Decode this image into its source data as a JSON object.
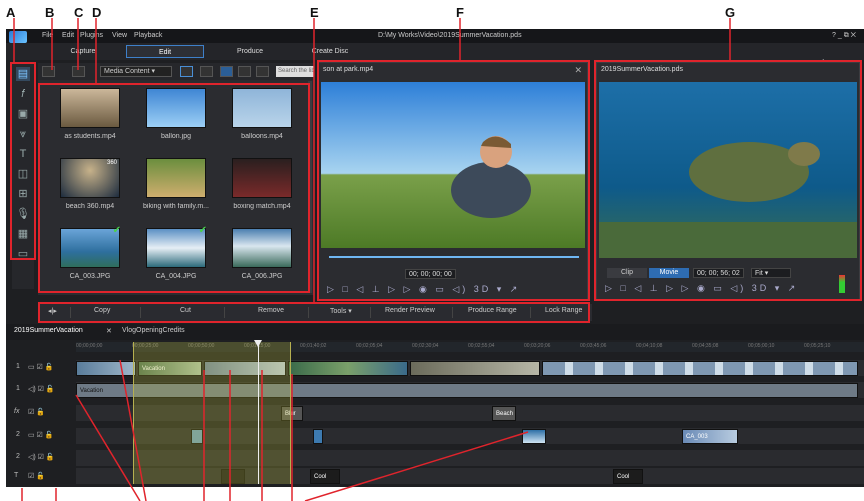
{
  "callouts": [
    "A",
    "B",
    "C",
    "D",
    "E",
    "F",
    "G"
  ],
  "app": {
    "menu": [
      "File",
      "Edit",
      "Plugins",
      "View",
      "Playback"
    ],
    "path": "D:\\My Works\\Video\\2019SummerVacation.pds",
    "window_controls": "?  _  ⧉  ✕",
    "modes": [
      "Capture",
      "Edit",
      "Produce",
      "Create Disc"
    ],
    "brand": "PowerDirector"
  },
  "library": {
    "filter": "Media Content",
    "search_placeholder": "Search the library",
    "items": [
      {
        "name": "as students.mp4",
        "checked": false
      },
      {
        "name": "ballon.jpg",
        "checked": false
      },
      {
        "name": "balloons.mp4",
        "checked": false
      },
      {
        "name": "beach 360.mp4",
        "checked": false,
        "badge": "360"
      },
      {
        "name": "biking with family.m...",
        "checked": false
      },
      {
        "name": "boxing match.mp4",
        "checked": false
      },
      {
        "name": "CA_003.JPG",
        "checked": true
      },
      {
        "name": "CA_004.JPG",
        "checked": true
      },
      {
        "name": "CA_006.JPG",
        "checked": false
      }
    ]
  },
  "preview_left": {
    "title": "son at park.mp4",
    "timecode": "00; 00; 00; 00",
    "controls": "▷ □ ◁ ⊥ ▷ ▷ ◉ ▭ ◁) 3D ▾ ↗"
  },
  "preview_right": {
    "title": "2019SummerVacation.pds",
    "clip_label": "Clip",
    "movie_label": "Movie",
    "timecode": "00; 00; 56; 02",
    "fit": "Fit",
    "controls": "▷ □ ◁ ⊥ ▷ ▷ ◉ ▭ ◁) 3D ▾ ↗"
  },
  "editbar": {
    "buttons": [
      "Copy",
      "Cut",
      "Remove",
      "Tools",
      "Render Preview",
      "Produce Range",
      "Lock Range"
    ]
  },
  "tabs": [
    "2019SummerVacation",
    "VlogOpeningCredits"
  ],
  "ruler": [
    "00;00;00;00",
    "00;00;25;00",
    "00;00;50;00",
    "00;01;15;00",
    "00;01;40;02",
    "00;02;05;04",
    "00;02;30;04",
    "00;02;55;04",
    "00;03;20;06",
    "00;03;45;06",
    "00;04;10;08",
    "00;04;35;08",
    "00;05;00;10",
    "00;05;25;10"
  ],
  "tracks": [
    "1",
    "1",
    "fx",
    "2",
    "2",
    "T"
  ],
  "clips": {
    "vacation": "Vacation",
    "vacation_audio": "Vacation",
    "blur": "Blur",
    "beach": "Beach",
    "ca003": "CA_003",
    "title1": "Cool",
    "title2": "Cool"
  }
}
